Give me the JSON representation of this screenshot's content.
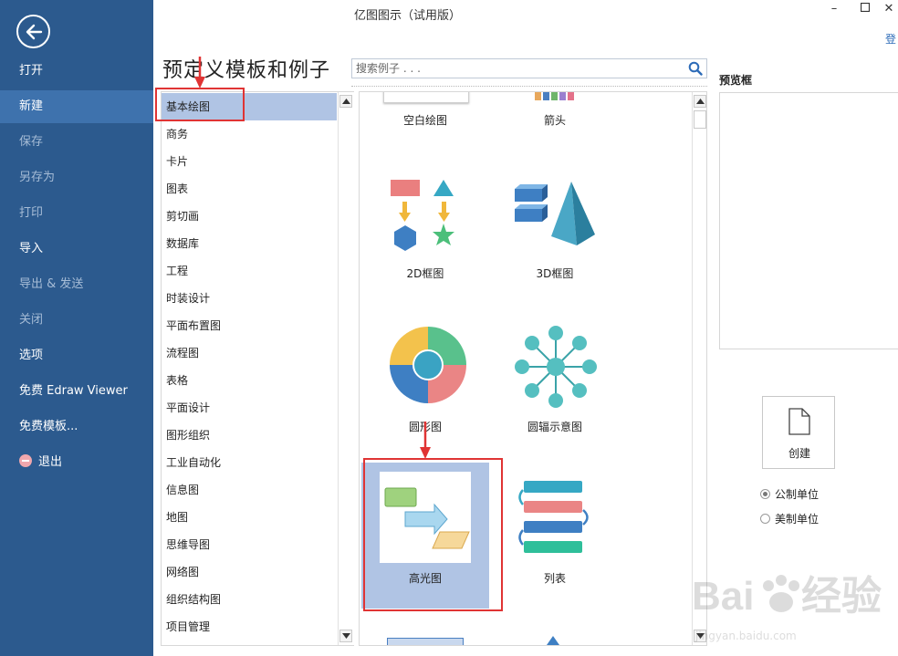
{
  "window": {
    "title": "亿图图示（试用版）",
    "login": "登"
  },
  "nav": {
    "items": [
      {
        "label": "打开"
      },
      {
        "label": "新建"
      },
      {
        "label": "保存"
      },
      {
        "label": "另存为"
      },
      {
        "label": "打印"
      },
      {
        "label": "导入"
      },
      {
        "label": "导出 & 发送"
      },
      {
        "label": "关闭"
      },
      {
        "label": "选项"
      },
      {
        "label": "免费 Edraw Viewer"
      },
      {
        "label": "免费模板..."
      },
      {
        "label": "退出"
      }
    ],
    "active": "新建"
  },
  "main": {
    "heading": "预定义模板和例子",
    "search_placeholder": "搜索例子 . . .",
    "categories": [
      "基本绘图",
      "商务",
      "卡片",
      "图表",
      "剪切画",
      "数据库",
      "工程",
      "时装设计",
      "平面布置图",
      "流程图",
      "表格",
      "平面设计",
      "图形组织",
      "工业自动化",
      "信息图",
      "地图",
      "思维导图",
      "网络图",
      "组织结构图",
      "项目管理"
    ],
    "selected_category": "基本绘图",
    "templates": [
      {
        "label": "空白绘图"
      },
      {
        "label": "箭头"
      },
      {
        "label": "2D框图"
      },
      {
        "label": "3D框图"
      },
      {
        "label": "圆形图"
      },
      {
        "label": "圆辐示意图"
      },
      {
        "label": "高光图"
      },
      {
        "label": "列表"
      }
    ],
    "selected_template": "高光图"
  },
  "side": {
    "preview_label": "预览框",
    "create_label": "创建",
    "units": [
      {
        "label": "公制单位",
        "selected": true
      },
      {
        "label": "美制单位",
        "selected": false
      }
    ]
  },
  "watermark": {
    "brand": "Baidu经验",
    "url": "jingyan.baidu.com"
  },
  "colors": {
    "nav_bg": "#2c5a8e",
    "nav_active": "#3e72ad",
    "selection": "#b0c4e4",
    "highlight_red": "#e03434"
  }
}
